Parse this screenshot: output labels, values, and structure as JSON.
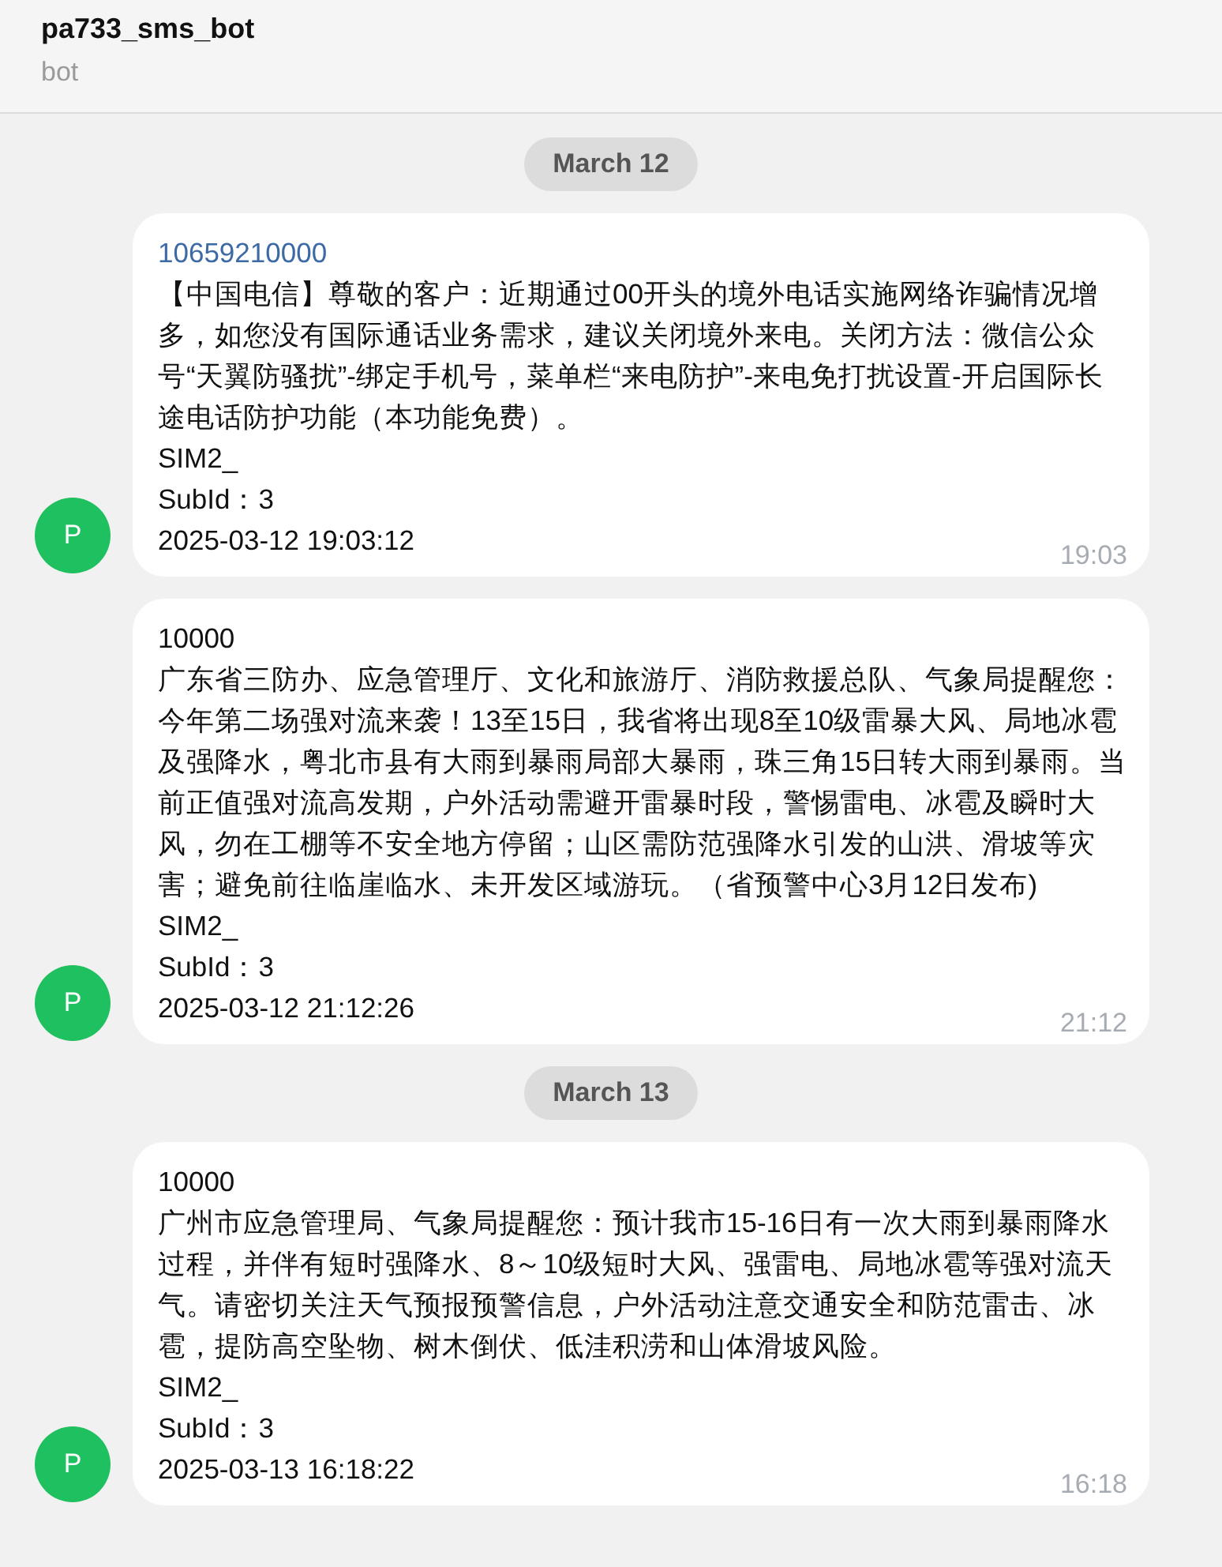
{
  "header": {
    "title": "pa733_sms_bot",
    "subtitle": "bot"
  },
  "groups": [
    {
      "date": "March 12",
      "messages": [
        {
          "avatar": "P",
          "sender": "10659210000",
          "sender_link": true,
          "body": "【中国电信】尊敬的客户：近期通过00开头的境外电话实施网络诈骗情况增多，如您没有国际通话业务需求，建议关闭境外来电。关闭方法：微信公众号“天翼防骚扰”-绑定手机号，菜单栏“来电防护”-来电免打扰设置-开启国际长途电话防护功能（本功能免费）。",
          "sim": "SIM2_",
          "subid": "SubId：3",
          "timestamp": "2025-03-12 19:03:12",
          "time": "19:03"
        },
        {
          "avatar": "P",
          "sender": "10000",
          "sender_link": false,
          "body": "广东省三防办、应急管理厅、文化和旅游厅、消防救援总队、气象局提醒您：今年第二场强对流来袭！13至15日，我省将出现8至10级雷暴大风、局地冰雹及强降水，粤北市县有大雨到暴雨局部大暴雨，珠三角15日转大雨到暴雨。当前正值强对流高发期，户外活动需避开雷暴时段，警惕雷电、冰雹及瞬时大风，勿在工棚等不安全地方停留；山区需防范强降水引发的山洪、滑坡等灾害；避免前往临崖临水、未开发区域游玩。（省预警中心3月12日发布)",
          "sim": "SIM2_",
          "subid": "SubId：3",
          "timestamp": "2025-03-12 21:12:26",
          "time": "21:12"
        }
      ]
    },
    {
      "date": "March 13",
      "messages": [
        {
          "avatar": "P",
          "sender": "10000",
          "sender_link": false,
          "body": "广州市应急管理局、气象局提醒您：预计我市15-16日有一次大雨到暴雨降水过程，并伴有短时强降水、8～10级短时大风、强雷电、局地冰雹等强对流天气。请密切关注天气预报预警信息，户外活动注意交通安全和防范雷击、冰雹，提防高空坠物、树木倒伏、低洼积涝和山体滑坡风险。",
          "sim": "SIM2_",
          "subid": "SubId：3",
          "timestamp": "2025-03-13 16:18:22",
          "time": "16:18"
        }
      ]
    }
  ]
}
